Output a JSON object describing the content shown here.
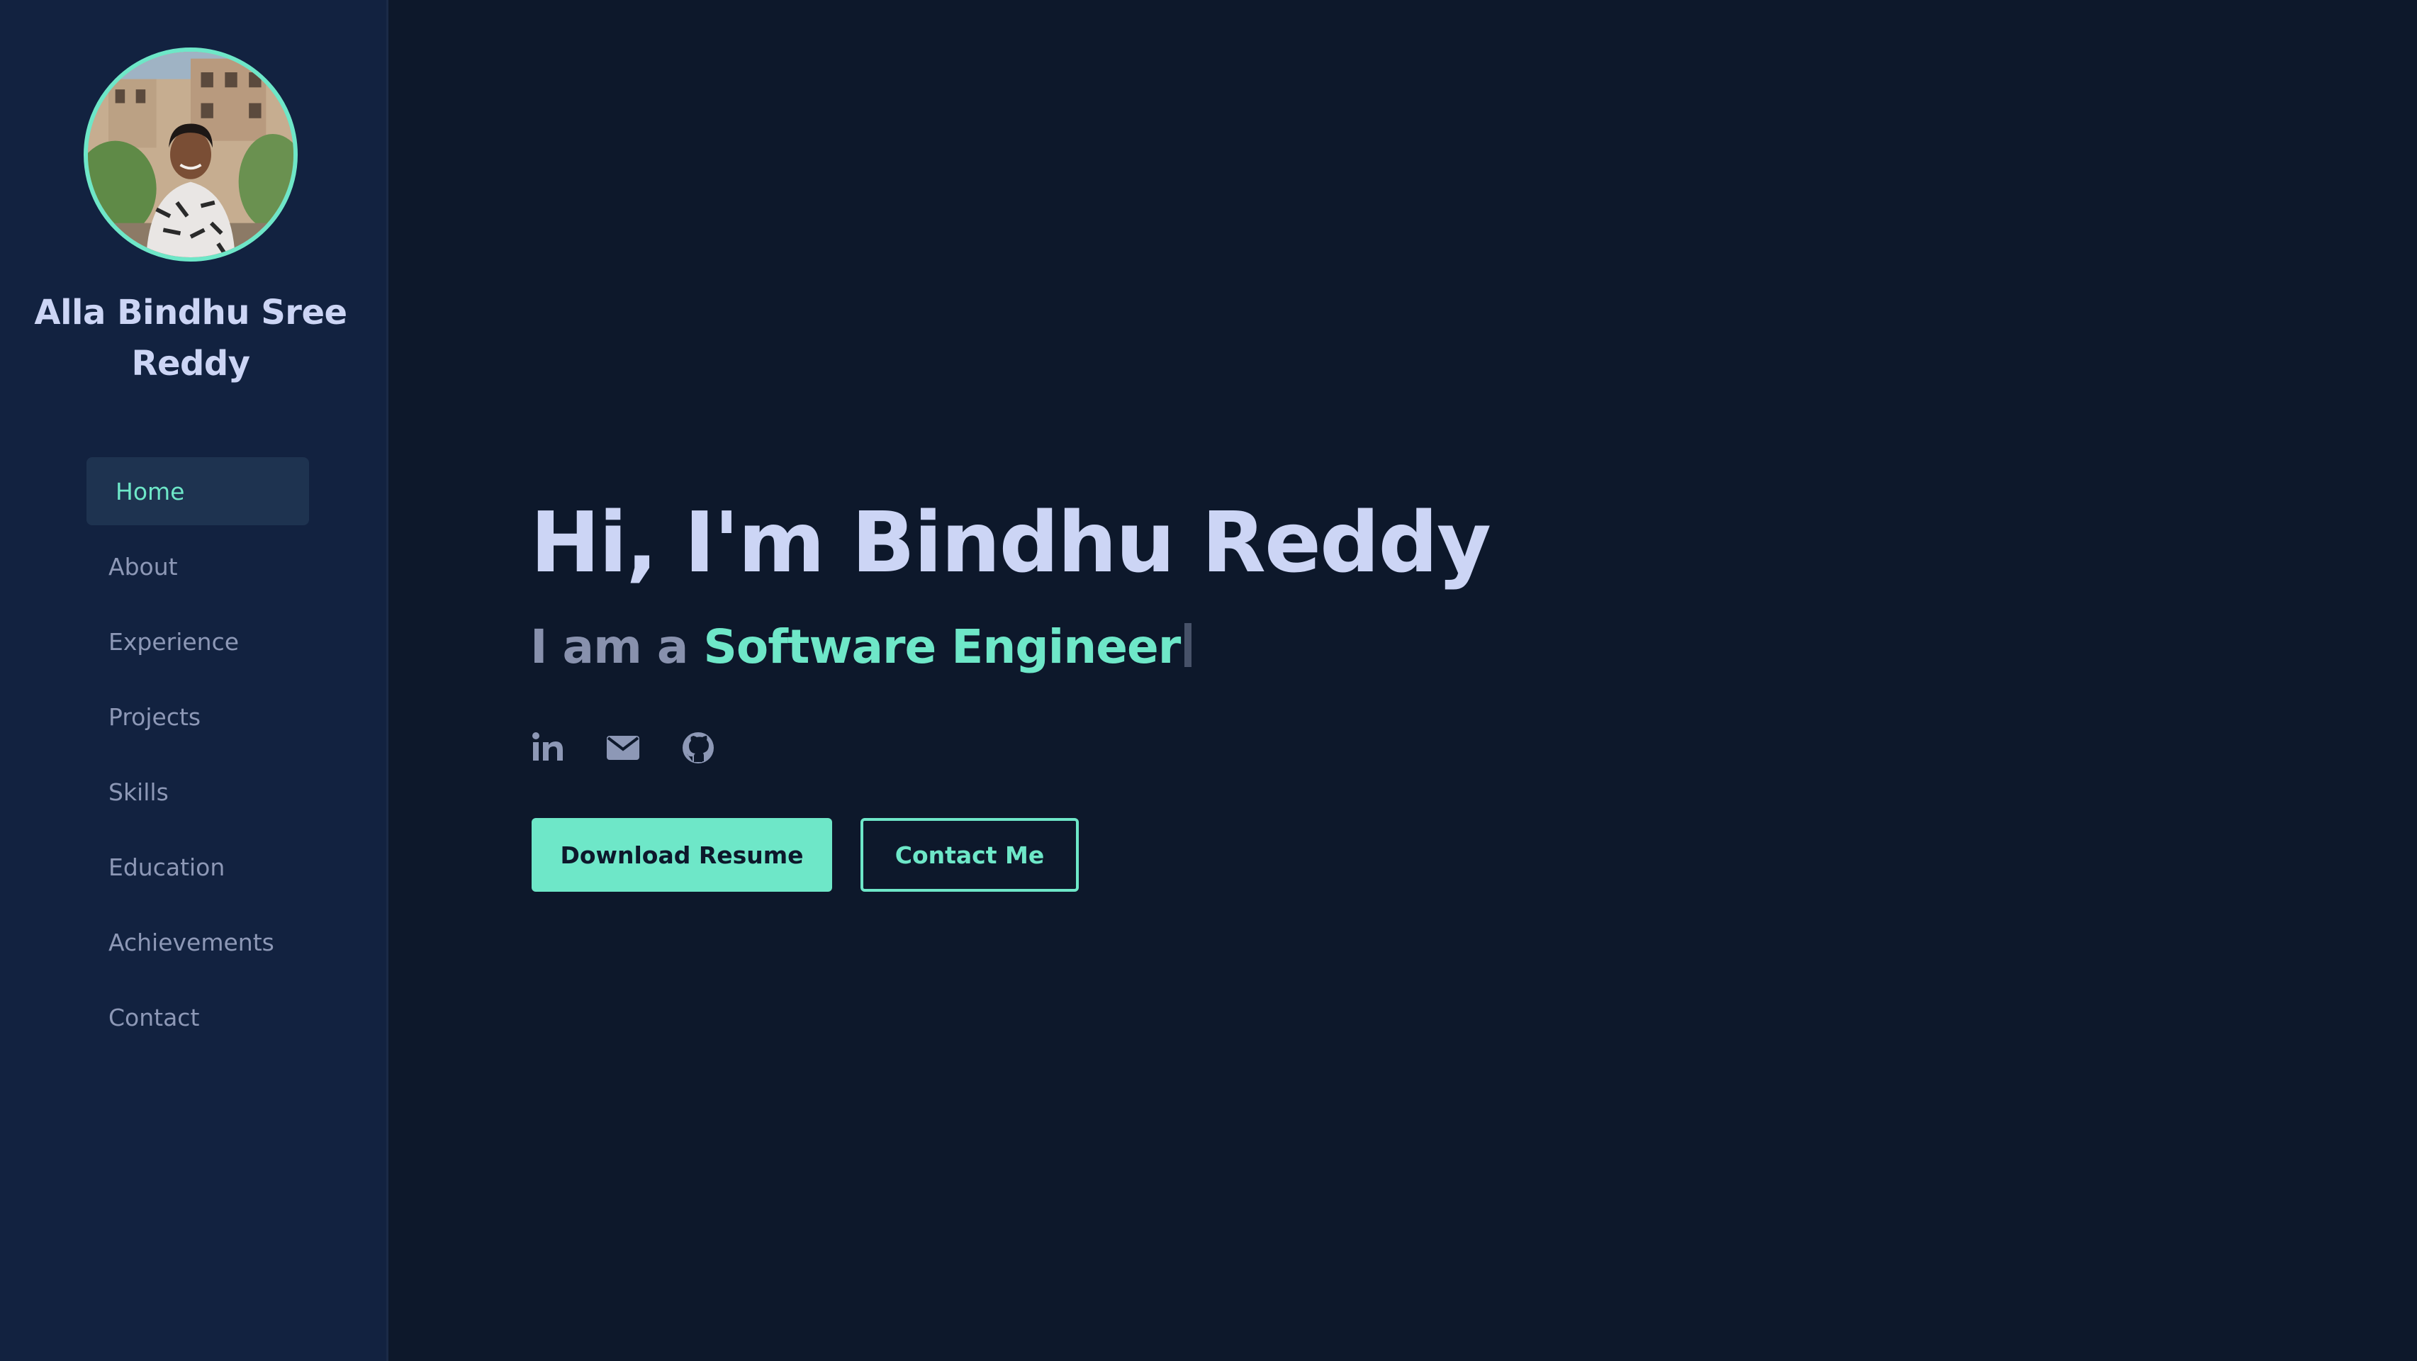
{
  "profile": {
    "name": "Alla Bindhu Sree Reddy"
  },
  "nav": {
    "items": [
      {
        "label": "Home",
        "active": true
      },
      {
        "label": "About"
      },
      {
        "label": "Experience"
      },
      {
        "label": "Projects"
      },
      {
        "label": "Skills"
      },
      {
        "label": "Education"
      },
      {
        "label": "Achievements"
      },
      {
        "label": "Contact"
      }
    ]
  },
  "hero": {
    "greeting": "Hi, I'm Bindhu Reddy",
    "subtitle_prefix": "I am a ",
    "role": "Software Engineer"
  },
  "socials": [
    {
      "icon": "linkedin-icon"
    },
    {
      "icon": "email-icon"
    },
    {
      "icon": "github-icon"
    }
  ],
  "buttons": {
    "download_resume": "Download Resume",
    "contact_me": "Contact Me"
  },
  "colors": {
    "accent": "#6ee7c8",
    "background": "#0d182b",
    "sidebar": "#122240",
    "heading": "#ccd5f5",
    "muted": "#8d98b6"
  }
}
